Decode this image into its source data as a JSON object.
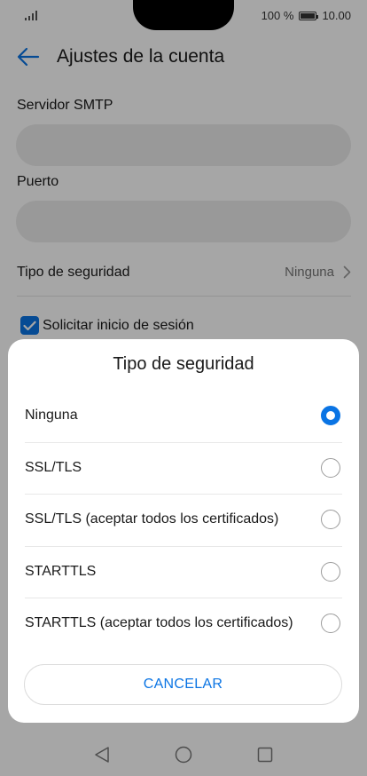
{
  "status_bar": {
    "battery_percent": "100 %",
    "time": "10.00"
  },
  "app_bar": {
    "title": "Ajustes de la cuenta"
  },
  "form": {
    "smtp_label": "Servidor SMTP",
    "smtp_value": "",
    "port_label": "Puerto",
    "port_value": "",
    "security_label": "Tipo de seguridad",
    "security_value": "Ninguna",
    "login_checkbox_label": "Solicitar inicio de sesión",
    "login_checked": true
  },
  "dialog": {
    "title": "Tipo de seguridad",
    "options": [
      {
        "label": "Ninguna",
        "selected": true
      },
      {
        "label": "SSL/TLS",
        "selected": false
      },
      {
        "label": "SSL/TLS (aceptar todos los certificados)",
        "selected": false
      },
      {
        "label": "STARTTLS",
        "selected": false
      },
      {
        "label": "STARTTLS (aceptar todos los certificados)",
        "selected": false
      }
    ],
    "cancel_label": "CANCELAR"
  },
  "colors": {
    "accent": "#0a74e4",
    "input_bg": "#ebebeb"
  },
  "icons": [
    "signal-icon",
    "battery-icon",
    "back-arrow-icon",
    "chevron-right-icon",
    "checkbox-checked-icon",
    "radio-icon",
    "nav-back-icon",
    "nav-home-icon",
    "nav-recents-icon"
  ]
}
